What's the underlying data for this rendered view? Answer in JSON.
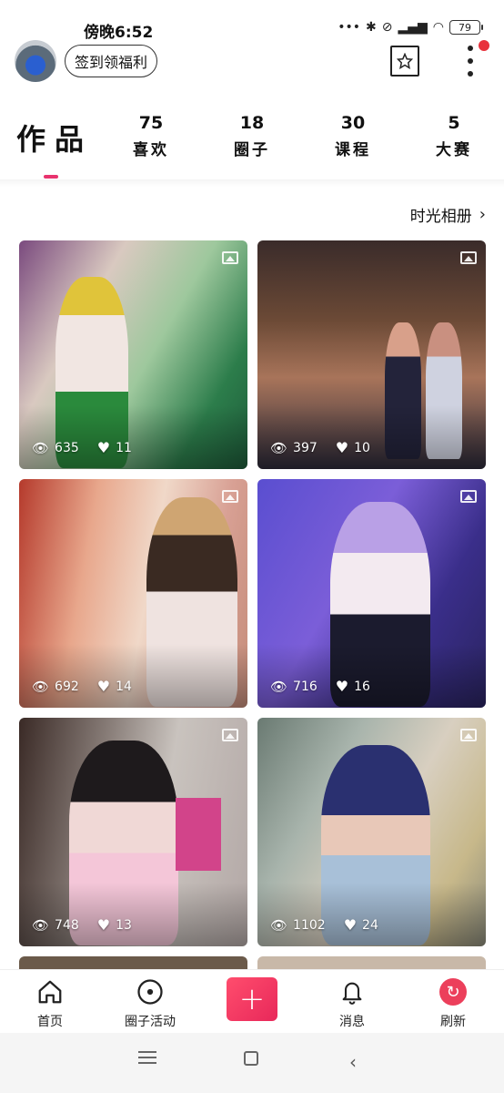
{
  "status_bar": {
    "time": "傍晚6:52",
    "icons": "··· ✱ ⊘ ⌇ ⌔",
    "battery": "79"
  },
  "header": {
    "checkin_label": "签到领福利",
    "star_icon": "★"
  },
  "tabs": {
    "main": "作品",
    "items": [
      {
        "count": "75",
        "label": "喜欢"
      },
      {
        "count": "18",
        "label": "圈子"
      },
      {
        "count": "30",
        "label": "课程"
      },
      {
        "count": "5",
        "label": "大赛"
      }
    ]
  },
  "album_link": "时光相册",
  "cards": [
    {
      "views": "635",
      "likes": "11"
    },
    {
      "views": "397",
      "likes": "10"
    },
    {
      "views": "692",
      "likes": "14"
    },
    {
      "views": "716",
      "likes": "16"
    },
    {
      "views": "748",
      "likes": "13"
    },
    {
      "views": "1102",
      "likes": "24"
    }
  ],
  "bottom_nav": {
    "home": "首页",
    "circle_activity": "圈子活动",
    "plus": "+",
    "messages": "消息",
    "refresh": "刷新"
  },
  "colors": {
    "accent": "#e8336e",
    "plus_button": "#ff4d6d",
    "notification_dot": "#e8323c"
  }
}
